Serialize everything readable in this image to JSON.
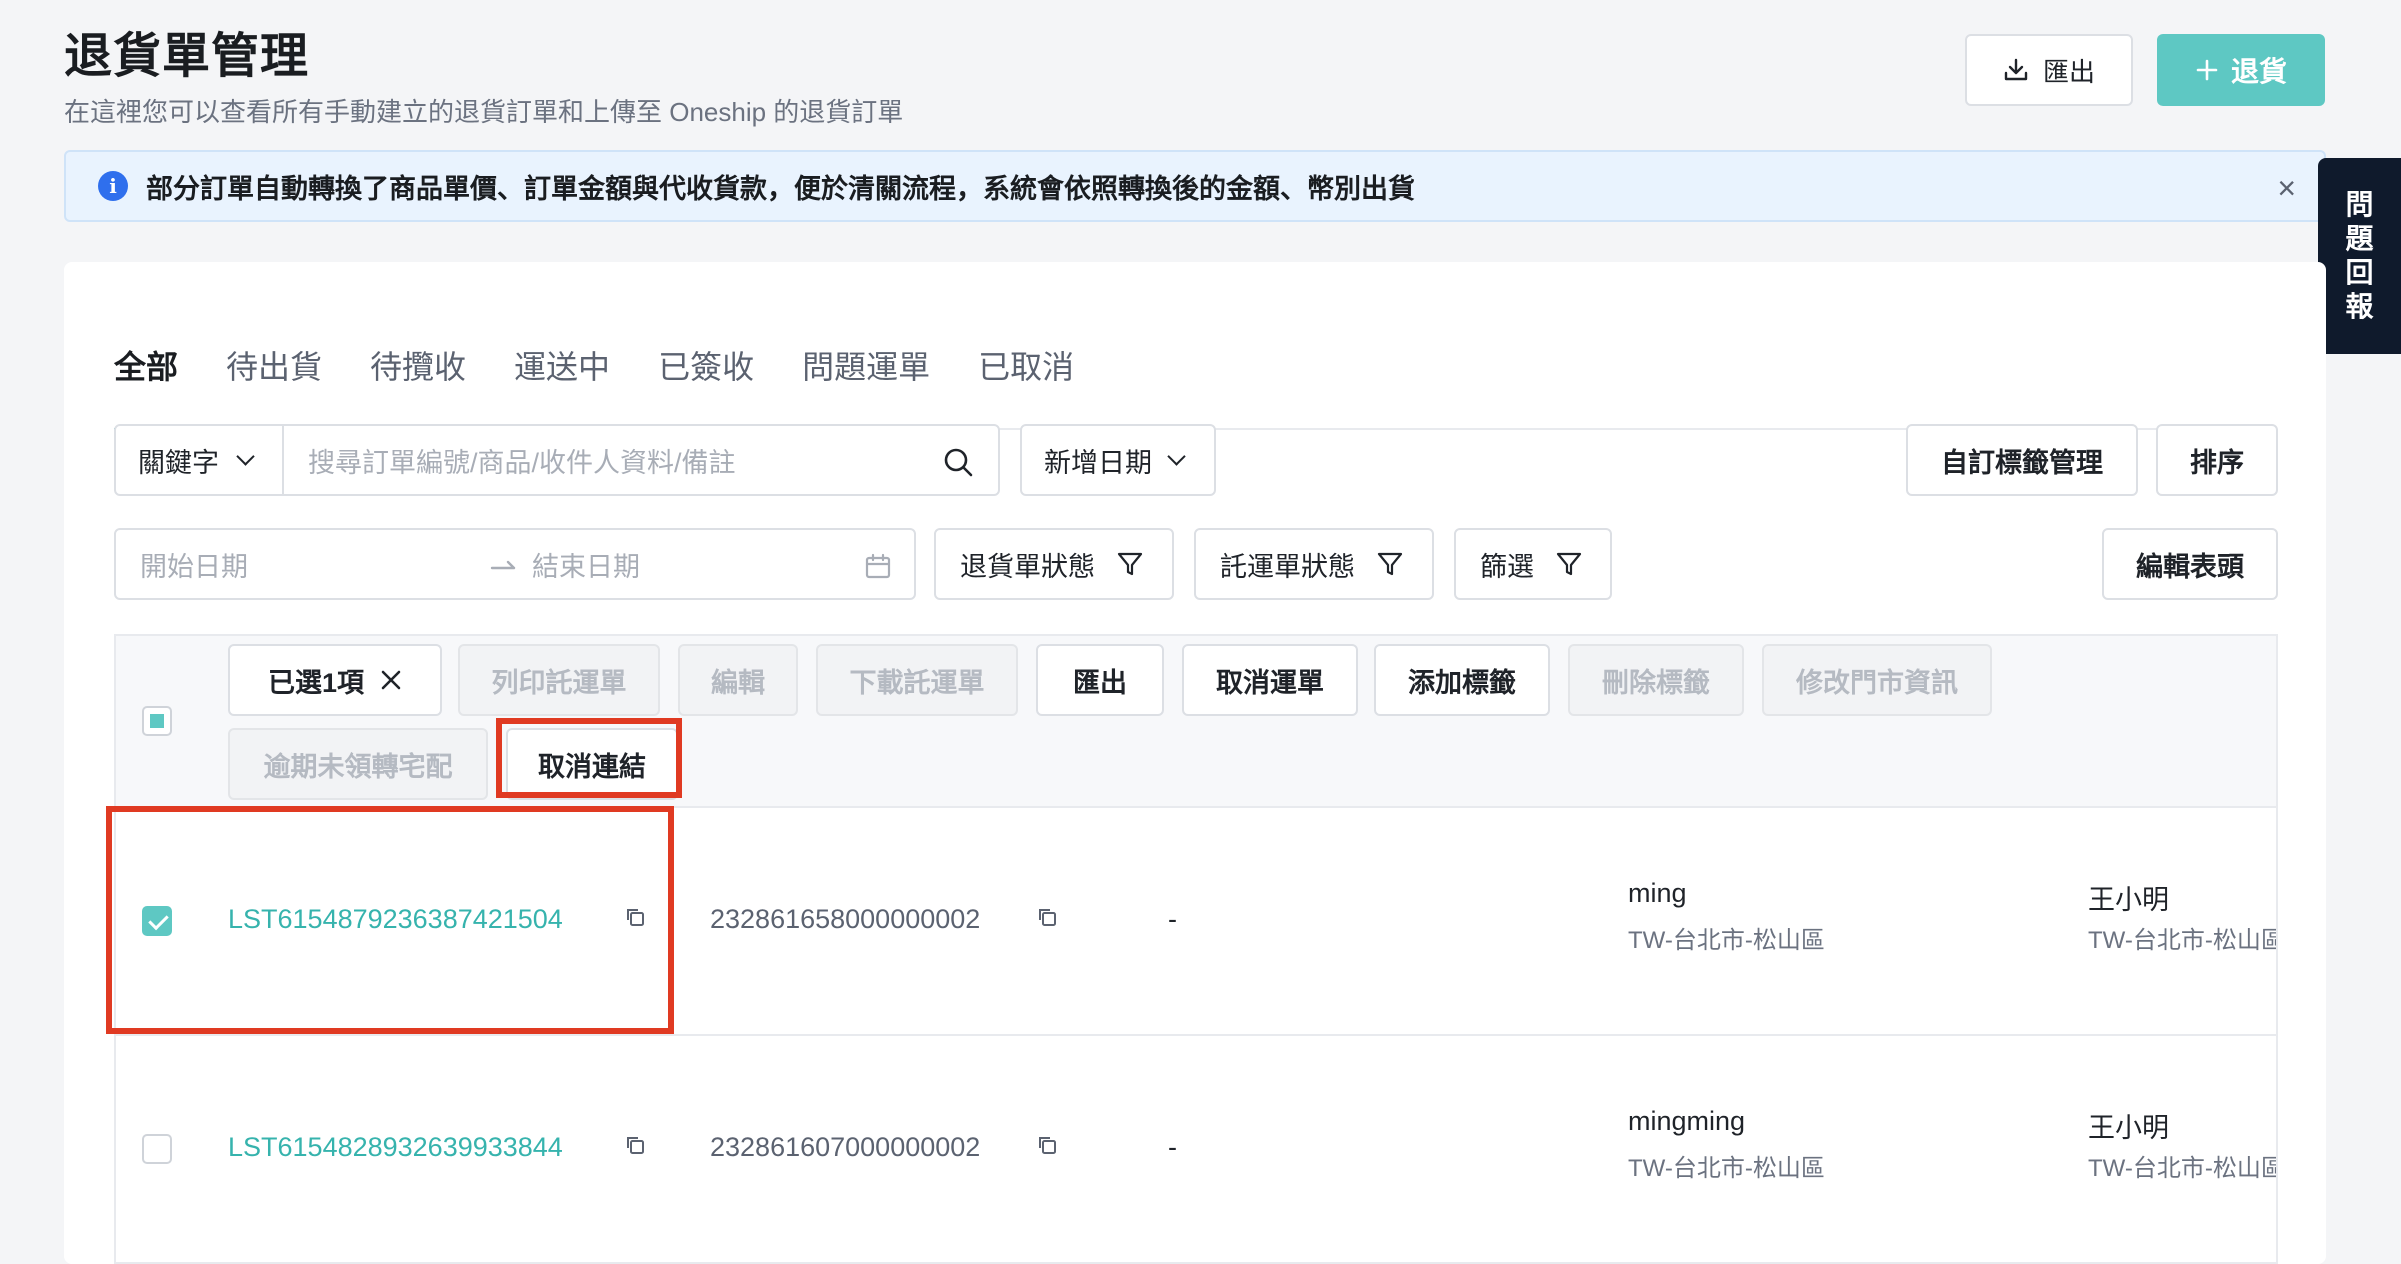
{
  "header": {
    "title": "退貨單管理",
    "subtitle": "在這裡您可以查看所有手動建立的退貨訂單和上傳至 Oneship 的退貨訂單",
    "export_label": "匯出",
    "return_label": "退貨"
  },
  "notice": {
    "text": "部分訂單自動轉換了商品單價、訂單金額與代收貨款，便於清關流程，系統會依照轉換後的金額、幣別出貨",
    "close": "×"
  },
  "feedback": {
    "chars": [
      "問",
      "題",
      "回",
      "報"
    ]
  },
  "tabs": [
    {
      "label": "全部",
      "active": true
    },
    {
      "label": "待出貨"
    },
    {
      "label": "待攬收"
    },
    {
      "label": "運送中"
    },
    {
      "label": "已簽收"
    },
    {
      "label": "問題運單"
    },
    {
      "label": "已取消"
    }
  ],
  "filters": {
    "keyword_select": "關鍵字",
    "search_placeholder": "搜尋訂單編號/商品/收件人資料/備註",
    "date_type": "新增日期",
    "custom_tags": "自訂標籤管理",
    "sort": "排序",
    "start_date_placeholder": "開始日期",
    "end_date_placeholder": "結束日期",
    "return_status": "退貨單狀態",
    "waybill_status": "託運單狀態",
    "filter": "篩選",
    "edit_header": "編輯表頭"
  },
  "toolbar": {
    "selected": "已選1項",
    "print_waybill": "列印託運單",
    "edit": "編輯",
    "download_waybill": "下載託運單",
    "export": "匯出",
    "cancel_waybill": "取消運單",
    "add_tag": "添加標籤",
    "delete_tag": "刪除標籤",
    "edit_store": "修改門市資訊",
    "overdue_home": "逾期未領轉宅配",
    "unlink": "取消連結"
  },
  "rows": [
    {
      "order_id": "LST6154879236387421504",
      "waybill": "232861658000000002",
      "dash": "-",
      "sender_name": "ming",
      "sender_area": "TW-台北市-松山區",
      "receiver_name": "王小明",
      "receiver_area": "TW-台北市-松山區",
      "checked": true
    },
    {
      "order_id": "LST6154828932639933844",
      "waybill": "232861607000000002",
      "dash": "-",
      "sender_name": "mingming",
      "sender_area": "TW-台北市-松山區",
      "receiver_name": "王小明",
      "receiver_area": "TW-台北市-松山區",
      "checked": false
    }
  ],
  "colors": {
    "accent": "#5ec8c3",
    "link": "#36b3ad",
    "info_bg": "#e9f3fe",
    "highlight": "#e03a22"
  }
}
